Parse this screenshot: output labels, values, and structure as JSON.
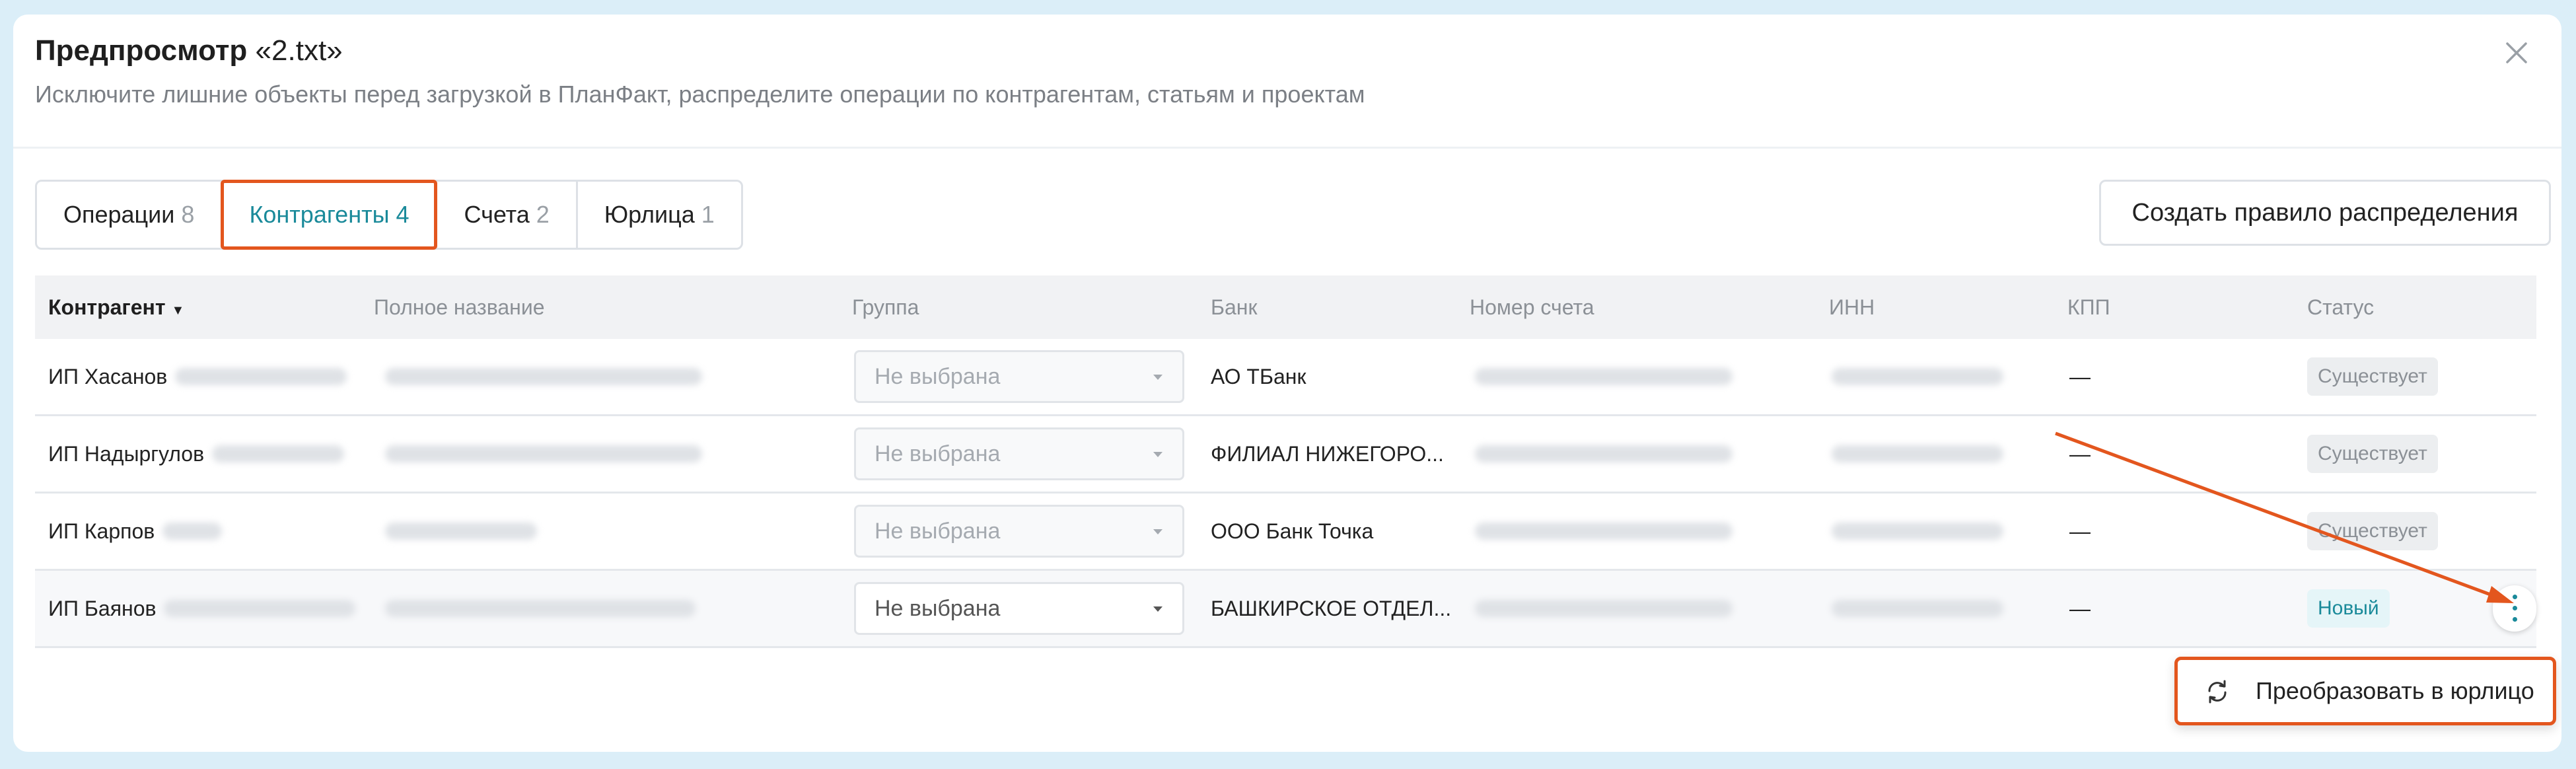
{
  "modal": {
    "title_bold": "Предпросмотр",
    "title_file": "«2.txt»",
    "subtitle": "Исключите лишние объекты перед загрузкой в ПланФакт, распределите операции по контрагентам, статьям и проектам"
  },
  "tabs": [
    {
      "label": "Операции",
      "count": "8"
    },
    {
      "label": "Контрагенты",
      "count": "4",
      "active": true
    },
    {
      "label": "Счета",
      "count": "2"
    },
    {
      "label": "Юрлица",
      "count": "1"
    }
  ],
  "create_rule_button": "Создать правило распределения",
  "table": {
    "columns": [
      "Контрагент",
      "Полное название",
      "Группа",
      "Банк",
      "Номер счета",
      "ИНН",
      "КПП",
      "Статус"
    ],
    "rows": [
      {
        "counterparty": "ИП Хасанов",
        "group": "Не выбрана",
        "bank": "АО ТБанк",
        "kpp": "—",
        "status": "Существует"
      },
      {
        "counterparty": "ИП Надыргулов",
        "group": "Не выбрана",
        "bank": "ФИЛИАЛ НИЖЕГОРО...",
        "kpp": "—",
        "status": "Существует"
      },
      {
        "counterparty": "ИП Карпов",
        "group": "Не выбрана",
        "bank": "ООО Банк Точка",
        "kpp": "—",
        "status": "Существует"
      },
      {
        "counterparty": "ИП Баянов",
        "group": "Не выбрана",
        "bank": "БАШКИРСКОЕ ОТДЕЛ...",
        "kpp": "—",
        "status": "Новый"
      }
    ]
  },
  "context_menu": {
    "item_label": "Преобразовать в юрлицо",
    "item_icon": "refresh-icon"
  },
  "colors": {
    "accent": "#1a8a9a",
    "highlight": "#e3561e"
  }
}
